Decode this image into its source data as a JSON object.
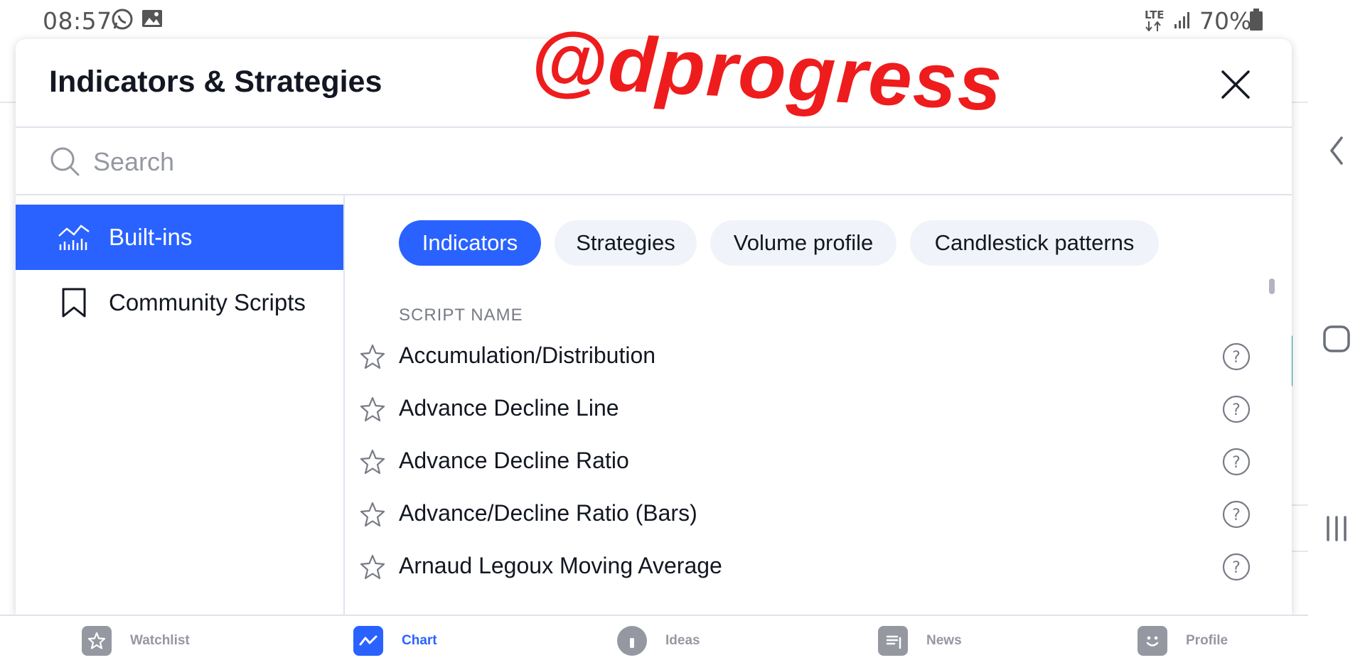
{
  "status_bar": {
    "time": "08:57",
    "network": "LTE",
    "battery": "70%"
  },
  "watermark": "@dprogress",
  "modal": {
    "title": "Indicators & Strategies",
    "search_placeholder": "Search",
    "sidebar": [
      {
        "label": "Built-ins",
        "icon": "chart-bars-icon",
        "active": true
      },
      {
        "label": "Community Scripts",
        "icon": "bookmark-icon",
        "active": false
      }
    ],
    "tabs": [
      {
        "label": "Indicators",
        "active": true
      },
      {
        "label": "Strategies",
        "active": false
      },
      {
        "label": "Volume profile",
        "active": false
      },
      {
        "label": "Candlestick patterns",
        "active": false
      }
    ],
    "column_header": "SCRIPT NAME",
    "scripts": [
      {
        "name": "Accumulation/Distribution"
      },
      {
        "name": "Advance Decline Line"
      },
      {
        "name": "Advance Decline Ratio"
      },
      {
        "name": "Advance/Decline Ratio (Bars)"
      },
      {
        "name": "Arnaud Legoux Moving Average"
      }
    ]
  },
  "bottom_tabs": [
    {
      "label": "Watchlist",
      "icon": "star-icon",
      "active": false
    },
    {
      "label": "Chart",
      "icon": "chart-icon",
      "active": true
    },
    {
      "label": "Ideas",
      "icon": "lightbulb-icon",
      "active": false
    },
    {
      "label": "News",
      "icon": "news-icon",
      "active": false
    },
    {
      "label": "Profile",
      "icon": "smiley-icon",
      "active": false
    }
  ],
  "colors": {
    "accent": "#2962ff",
    "watermark": "#ee1c1c",
    "muted": "#9598a1"
  }
}
